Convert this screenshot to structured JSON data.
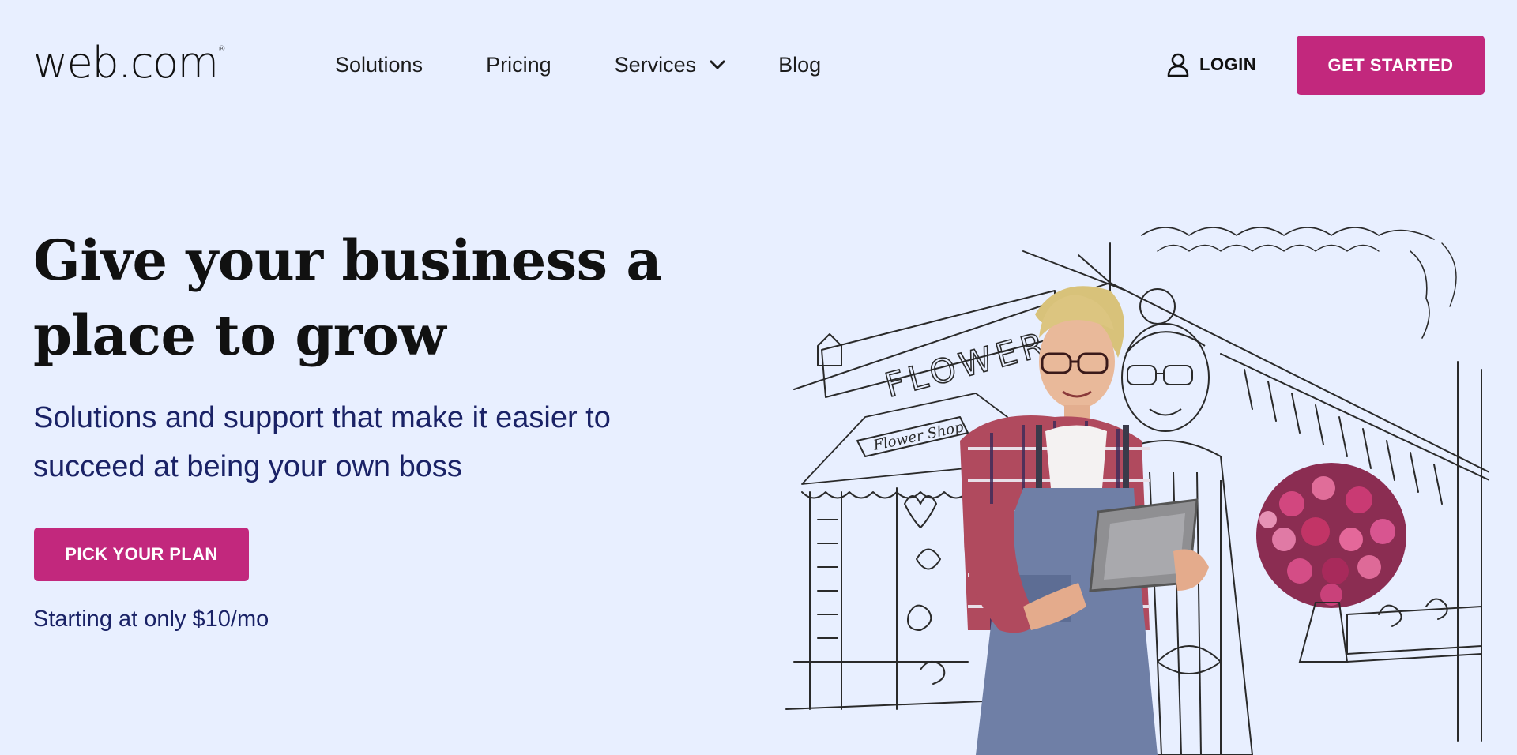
{
  "header": {
    "logo_text": "web.com",
    "logo_mark": "®",
    "nav": {
      "solutions": "Solutions",
      "pricing": "Pricing",
      "services": "Services",
      "blog": "Blog"
    },
    "login_label": "LOGIN",
    "get_started_label": "GET STARTED"
  },
  "hero": {
    "title_line1": "Give your business a",
    "title_line2": "place to grow",
    "subtitle_line1": "Solutions and support that make it easier to",
    "subtitle_line2": "succeed at being your own boss",
    "cta_label": "PICK YOUR PLAN",
    "price_note": "Starting at only $10/mo"
  },
  "illustration": {
    "sign_text": "FLOWER",
    "small_sign_text": "Flower Shop"
  },
  "colors": {
    "background": "#e8efff",
    "accent": "#c2287d",
    "subtitle_text": "#1a2266"
  },
  "icons": {
    "chevron": "chevron-down-icon",
    "user": "user-icon"
  }
}
